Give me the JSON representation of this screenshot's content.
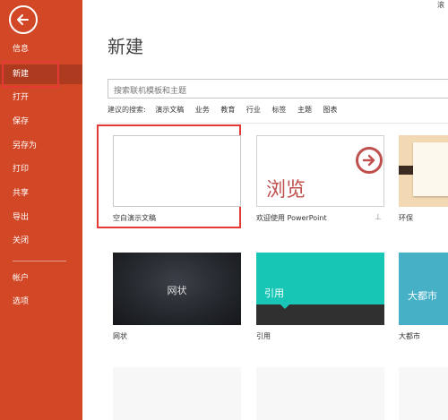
{
  "sidebar": {
    "items": [
      {
        "label": "信息"
      },
      {
        "label": "新建"
      },
      {
        "label": "打开"
      },
      {
        "label": "保存"
      },
      {
        "label": "另存为"
      },
      {
        "label": "打印"
      },
      {
        "label": "共享"
      },
      {
        "label": "导出"
      },
      {
        "label": "关闭"
      },
      {
        "label": "帐户"
      },
      {
        "label": "选项"
      }
    ],
    "active": "新建"
  },
  "main": {
    "title": "新建",
    "top_right_glyph": "滚",
    "search": {
      "placeholder": "搜索联机模板和主题"
    },
    "suggest": {
      "label": "建议的搜索:",
      "links": [
        "演示文稿",
        "业务",
        "教育",
        "行业",
        "标签",
        "主题",
        "图表"
      ]
    },
    "templates": [
      {
        "label": "空白演示文稿"
      },
      {
        "label": "欢迎使用 PowerPoint",
        "thumb_text": "浏览"
      },
      {
        "label": "环保"
      },
      {
        "label": "网状",
        "thumb_text": "网状"
      },
      {
        "label": "引用",
        "thumb_text": "引用"
      },
      {
        "label": "大都市",
        "thumb_text": "大都市"
      }
    ]
  },
  "colors": {
    "sidebar": "#d24726",
    "sidebar_active": "#ae3a1f",
    "highlight": "#e53935",
    "teal": "#17c6b5",
    "metro": "#46b0c6"
  }
}
